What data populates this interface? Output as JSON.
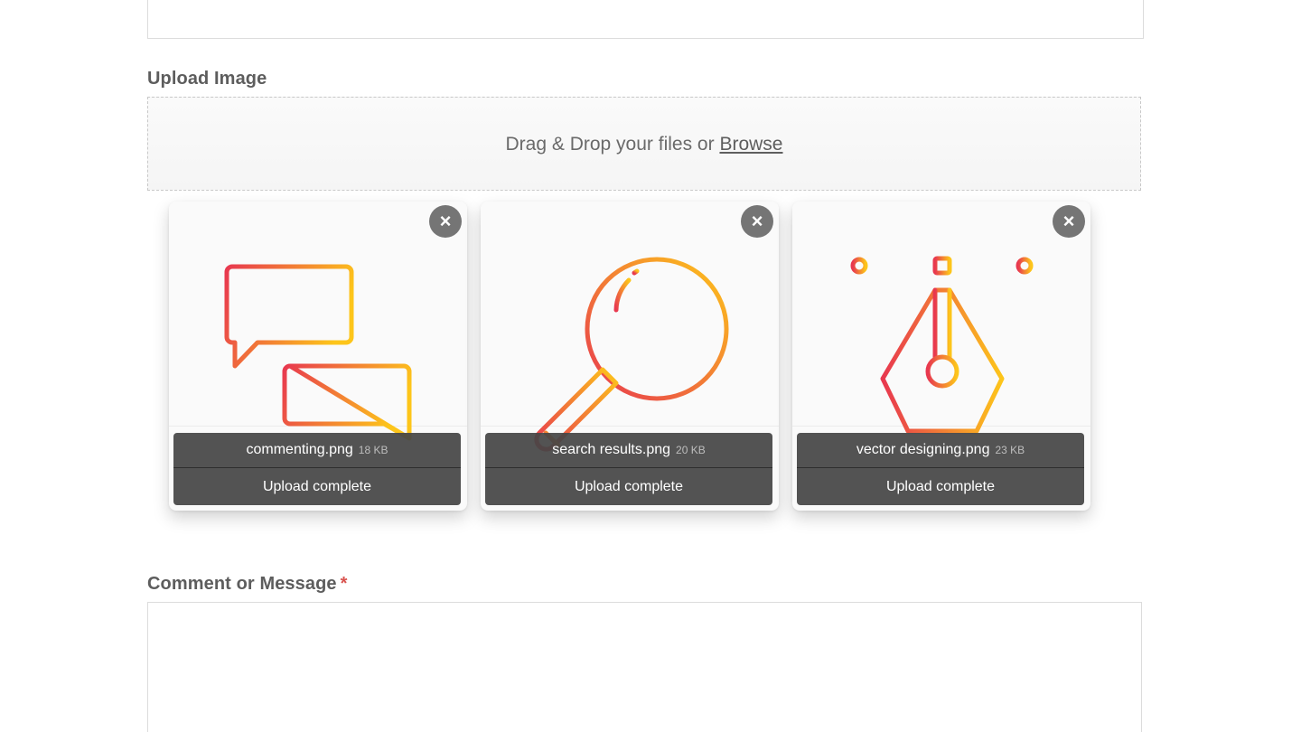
{
  "upload": {
    "label": "Upload Image",
    "dropzone_text": "Drag & Drop your files or",
    "browse_label": "Browse"
  },
  "files": [
    {
      "name": "commenting.png",
      "size": "18 KB",
      "status": "Upload complete",
      "remove": "×",
      "icon": "chat-bubbles-icon"
    },
    {
      "name": "search results.png",
      "size": "20 KB",
      "status": "Upload complete",
      "remove": "×",
      "icon": "magnifier-icon"
    },
    {
      "name": "vector designing.png",
      "size": "23 KB",
      "status": "Upload complete",
      "remove": "×",
      "icon": "pen-tool-icon"
    }
  ],
  "comment": {
    "label": "Comment or Message",
    "required_mark": "*"
  },
  "colors": {
    "gradient_start": "#e8384f",
    "gradient_end": "#fdc51a",
    "overlay": "#464646",
    "remove_button": "#757575"
  }
}
